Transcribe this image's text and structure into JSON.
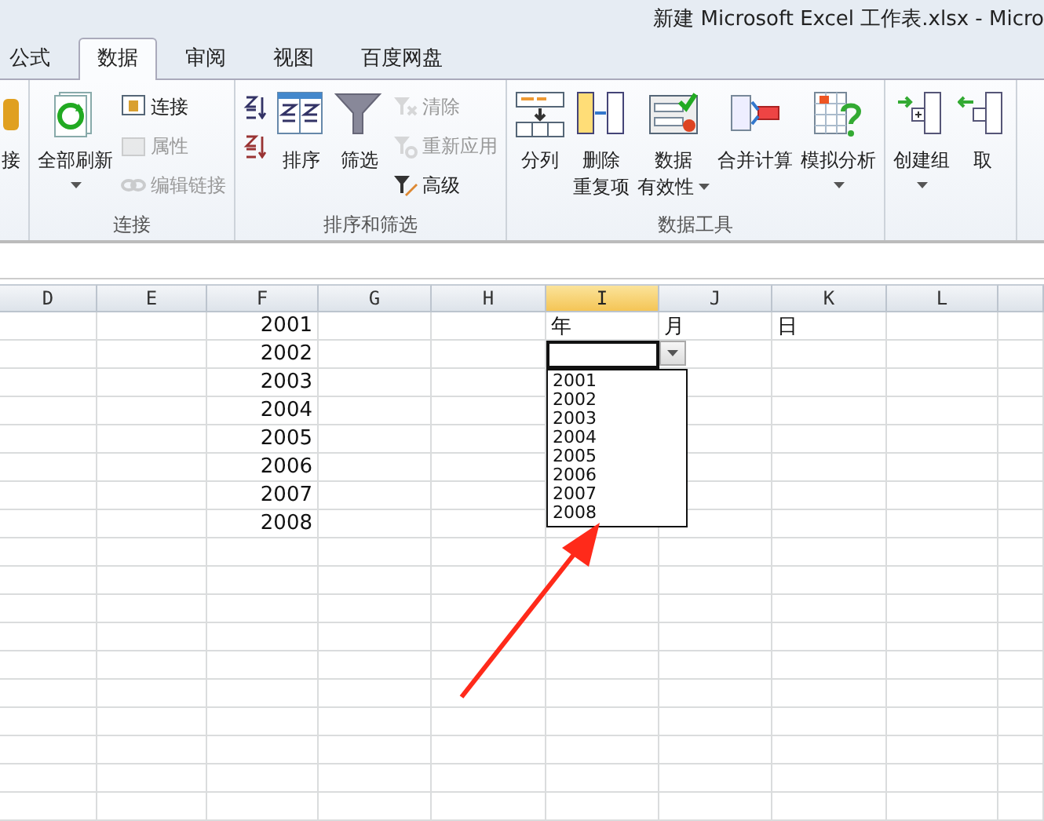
{
  "window": {
    "title": "新建 Microsoft Excel 工作表.xlsx  -  Micro"
  },
  "tabs": [
    {
      "label": "公式",
      "selected": false
    },
    {
      "label": "数据",
      "selected": true
    },
    {
      "label": "审阅",
      "selected": false
    },
    {
      "label": "视图",
      "selected": false
    },
    {
      "label": "百度网盘",
      "selected": false
    }
  ],
  "ribbon": {
    "groups": [
      {
        "items": [
          {
            "kind": "large",
            "lines": [
              "接"
            ],
            "disabled": false,
            "dropdown": false
          }
        ]
      },
      {
        "label": "连接",
        "items": [
          {
            "kind": "large",
            "lines": [
              "全部刷新"
            ],
            "disabled": false,
            "dropdown": true
          },
          {
            "kind": "stack",
            "items": [
              {
                "label": "连接",
                "disabled": false
              },
              {
                "label": "属性",
                "disabled": true
              },
              {
                "label": "编辑链接",
                "disabled": true
              }
            ]
          }
        ]
      },
      {
        "label": "排序和筛选",
        "items": [
          {
            "kind": "stack",
            "items": [
              {
                "disabled": false
              },
              {
                "disabled": false
              }
            ]
          },
          {
            "kind": "large",
            "lines": [
              "排序"
            ],
            "disabled": false,
            "dropdown": false
          },
          {
            "kind": "large",
            "lines": [
              "筛选"
            ],
            "disabled": false,
            "dropdown": false
          },
          {
            "kind": "stack",
            "items": [
              {
                "label": "清除",
                "disabled": true
              },
              {
                "label": "重新应用",
                "disabled": true
              },
              {
                "label": "高级",
                "disabled": false
              }
            ]
          }
        ]
      },
      {
        "label": "数据工具",
        "items": [
          {
            "kind": "large",
            "lines": [
              "分列"
            ],
            "disabled": false,
            "dropdown": false
          },
          {
            "kind": "large",
            "lines": [
              "删除",
              "重复项"
            ],
            "disabled": false,
            "dropdown": false
          },
          {
            "kind": "large",
            "lines": [
              "数据",
              "有效性"
            ],
            "disabled": false,
            "dropdown": true
          },
          {
            "kind": "large",
            "lines": [
              "合并计算"
            ],
            "disabled": false,
            "dropdown": false
          },
          {
            "kind": "large",
            "lines": [
              "模拟分析"
            ],
            "disabled": false,
            "dropdown": true
          }
        ]
      },
      {
        "items": [
          {
            "kind": "large",
            "lines": [
              "创建组"
            ],
            "disabled": false,
            "dropdown": true
          },
          {
            "kind": "large",
            "lines": [
              "取"
            ],
            "disabled": false,
            "dropdown": false
          }
        ]
      }
    ]
  },
  "sheet": {
    "columns": [
      {
        "label": "D",
        "selected": false
      },
      {
        "label": "E",
        "selected": false
      },
      {
        "label": "F",
        "selected": false
      },
      {
        "label": "G",
        "selected": false
      },
      {
        "label": "H",
        "selected": false
      },
      {
        "label": "I",
        "selected": true
      },
      {
        "label": "J",
        "selected": false
      },
      {
        "label": "K",
        "selected": false
      },
      {
        "label": "L",
        "selected": false
      },
      {
        "selected": false
      }
    ],
    "rows": [
      [
        "",
        "",
        "2001",
        "",
        "",
        "年",
        "月",
        "日",
        "",
        ""
      ],
      [
        "",
        "",
        "2002",
        "",
        "",
        {
          "selected": true
        },
        "",
        "",
        "",
        ""
      ],
      [
        "",
        "",
        "2003",
        "",
        "",
        "",
        "",
        "",
        "",
        ""
      ],
      [
        "",
        "",
        "2004",
        "",
        "",
        "",
        "",
        "",
        "",
        ""
      ],
      [
        "",
        "",
        "2005",
        "",
        "",
        "",
        "",
        "",
        "",
        ""
      ],
      [
        "",
        "",
        "2006",
        "",
        "",
        "",
        "",
        "",
        "",
        ""
      ],
      [
        "",
        "",
        "2007",
        "",
        "",
        "",
        "",
        "",
        "",
        ""
      ],
      [
        "",
        "",
        "2008",
        "",
        "",
        "",
        "",
        "",
        "",
        ""
      ]
    ],
    "dropdown_list": [
      "2001",
      "2002",
      "2003",
      "2004",
      "2005",
      "2006",
      "2007",
      "2008"
    ]
  },
  "annotation": {
    "kind": "arrow",
    "color": "#ff2a1a"
  }
}
